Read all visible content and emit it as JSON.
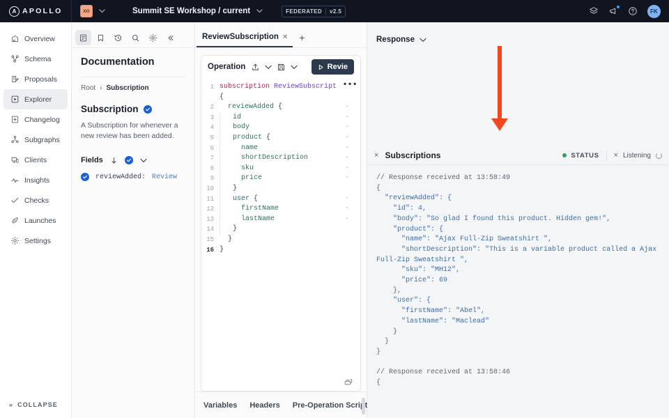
{
  "topbar": {
    "brand": "APOLLO",
    "brand_letter": "A",
    "graph_badge_label": "XO",
    "graph_title": "Summit SE Workshop / current",
    "federated_label": "FEDERATED",
    "version_label": "v2.5",
    "avatar_initials": "FK"
  },
  "sidebar": {
    "items": [
      {
        "label": "Overview",
        "icon": "overview-icon",
        "active": false
      },
      {
        "label": "Schema",
        "icon": "schema-icon",
        "active": false
      },
      {
        "label": "Proposals",
        "icon": "proposals-icon",
        "active": false
      },
      {
        "label": "Explorer",
        "icon": "explorer-icon",
        "active": true
      },
      {
        "label": "Changelog",
        "icon": "changelog-icon",
        "active": false
      },
      {
        "label": "Subgraphs",
        "icon": "subgraphs-icon",
        "active": false
      },
      {
        "label": "Clients",
        "icon": "clients-icon",
        "active": false
      },
      {
        "label": "Insights",
        "icon": "insights-icon",
        "active": false
      },
      {
        "label": "Checks",
        "icon": "checks-icon",
        "active": false
      },
      {
        "label": "Launches",
        "icon": "launches-icon",
        "active": false
      },
      {
        "label": "Settings",
        "icon": "settings-icon",
        "active": false
      }
    ],
    "collapse_label": "COLLAPSE"
  },
  "documentation": {
    "title": "Documentation",
    "breadcrumb_root": "Root",
    "breadcrumb_sep": "›",
    "breadcrumb_current": "Subscription",
    "heading": "Subscription",
    "description": "A Subscription for whenever a new review has been added.",
    "fields_label": "Fields",
    "fields": [
      {
        "name": "reviewAdded:",
        "type": "Review"
      }
    ]
  },
  "operation": {
    "tab_label": "ReviewSubscription",
    "tab_close": "×",
    "add_tab": "+",
    "panel_label": "Operation",
    "run_button": "Revie",
    "code_lines": [
      {
        "n": "1",
        "text": "subscription ReviewSubscript",
        "dash": false
      },
      {
        "n": "",
        "text": "{",
        "dash": false
      },
      {
        "n": "2",
        "text": "  reviewAdded {",
        "dash": true
      },
      {
        "n": "3",
        "text": "    id",
        "dash": true
      },
      {
        "n": "4",
        "text": "    body",
        "dash": true
      },
      {
        "n": "5",
        "text": "    product {",
        "dash": true
      },
      {
        "n": "6",
        "text": "      name",
        "dash": true
      },
      {
        "n": "7",
        "text": "      shortDescription",
        "dash": true
      },
      {
        "n": "8",
        "text": "      sku",
        "dash": true
      },
      {
        "n": "9",
        "text": "      price",
        "dash": true
      },
      {
        "n": "10",
        "text": "    }",
        "dash": false
      },
      {
        "n": "11",
        "text": "    user {",
        "dash": true
      },
      {
        "n": "12",
        "text": "      firstName",
        "dash": true
      },
      {
        "n": "13",
        "text": "      lastName",
        "dash": true
      },
      {
        "n": "14",
        "text": "    }",
        "dash": false
      },
      {
        "n": "15",
        "text": "  }",
        "dash": false
      },
      {
        "n": "16",
        "text": "}",
        "dash": false
      }
    ],
    "code_overflow_dots": "•••",
    "bottom_tabs": [
      "Variables",
      "Headers",
      "Pre-Operation Script"
    ]
  },
  "response": {
    "label": "Response",
    "subscriptions_label": "Subscriptions",
    "status_label": "STATUS",
    "status_color": "#28a164",
    "listening_label": "Listening",
    "lines": [
      "// Response received at 13:58:49",
      "{",
      "  \"reviewAdded\": {",
      "    \"id\": 4,",
      "    \"body\": \"So glad I found this product. Hidden gem!\",",
      "    \"product\": {",
      "      \"name\": \"Ajax Full-Zip Sweatshirt \",",
      "      \"shortDescription\": \"This is a variable product called a Ajax Full-Zip Sweatshirt \",",
      "      \"sku\": \"MH12\",",
      "      \"price\": 69",
      "    },",
      "    \"user\": {",
      "      \"firstName\": \"Abel\",",
      "      \"lastName\": \"Maclead\"",
      "    }",
      "  }",
      "}",
      "",
      "// Response received at 13:58:46",
      "{"
    ]
  },
  "annotation": {
    "arrow_color": "#f0481e"
  }
}
